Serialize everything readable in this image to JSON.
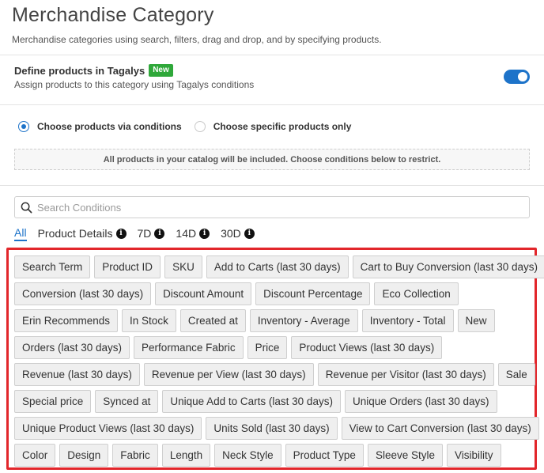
{
  "header": {
    "title": "Merchandise Category",
    "subtitle": "Merchandise categories using search, filters, drag and drop, and by specifying products."
  },
  "define": {
    "title": "Define products in Tagalys",
    "badge": "New",
    "description": "Assign products to this category using Tagalys conditions",
    "toggle_on": true
  },
  "radios": [
    {
      "label": "Choose products via conditions",
      "checked": true
    },
    {
      "label": "Choose specific products only",
      "checked": false
    }
  ],
  "info_message": "All products in your catalog will be included. Choose conditions below to restrict.",
  "search": {
    "placeholder": "Search Conditions",
    "value": ""
  },
  "tabs": [
    {
      "label": "All",
      "active": true,
      "info": false
    },
    {
      "label": "Product Details",
      "active": false,
      "info": true
    },
    {
      "label": "7D",
      "active": false,
      "info": true
    },
    {
      "label": "14D",
      "active": false,
      "info": true
    },
    {
      "label": "30D",
      "active": false,
      "info": true
    }
  ],
  "conditions": [
    [
      "Search Term",
      "Product ID",
      "SKU",
      "Add to Carts (last 30 days)",
      "Cart to Buy Conversion (last 30 days)"
    ],
    [
      "Conversion (last 30 days)",
      "Discount Amount",
      "Discount Percentage",
      "Eco Collection"
    ],
    [
      "Erin Recommends",
      "In Stock",
      "Created at",
      "Inventory - Average",
      "Inventory - Total",
      "New"
    ],
    [
      "Orders (last 30 days)",
      "Performance Fabric",
      "Price",
      "Product Views (last 30 days)"
    ],
    [
      "Revenue (last 30 days)",
      "Revenue per View (last 30 days)",
      "Revenue per Visitor (last 30 days)",
      "Sale"
    ],
    [
      "Special price",
      "Synced at",
      "Unique Add to Carts (last 30 days)",
      "Unique Orders (last 30 days)"
    ],
    [
      "Unique Product Views (last 30 days)",
      "Units Sold (last 30 days)",
      "View to Cart Conversion (last 30 days)"
    ],
    [
      "Color",
      "Design",
      "Fabric",
      "Length",
      "Neck Style",
      "Product Type",
      "Sleeve Style",
      "Visibility"
    ]
  ],
  "colors": {
    "accent": "#1d73c9",
    "badge_green": "#2fa83a",
    "highlight_red": "#e2262b"
  }
}
